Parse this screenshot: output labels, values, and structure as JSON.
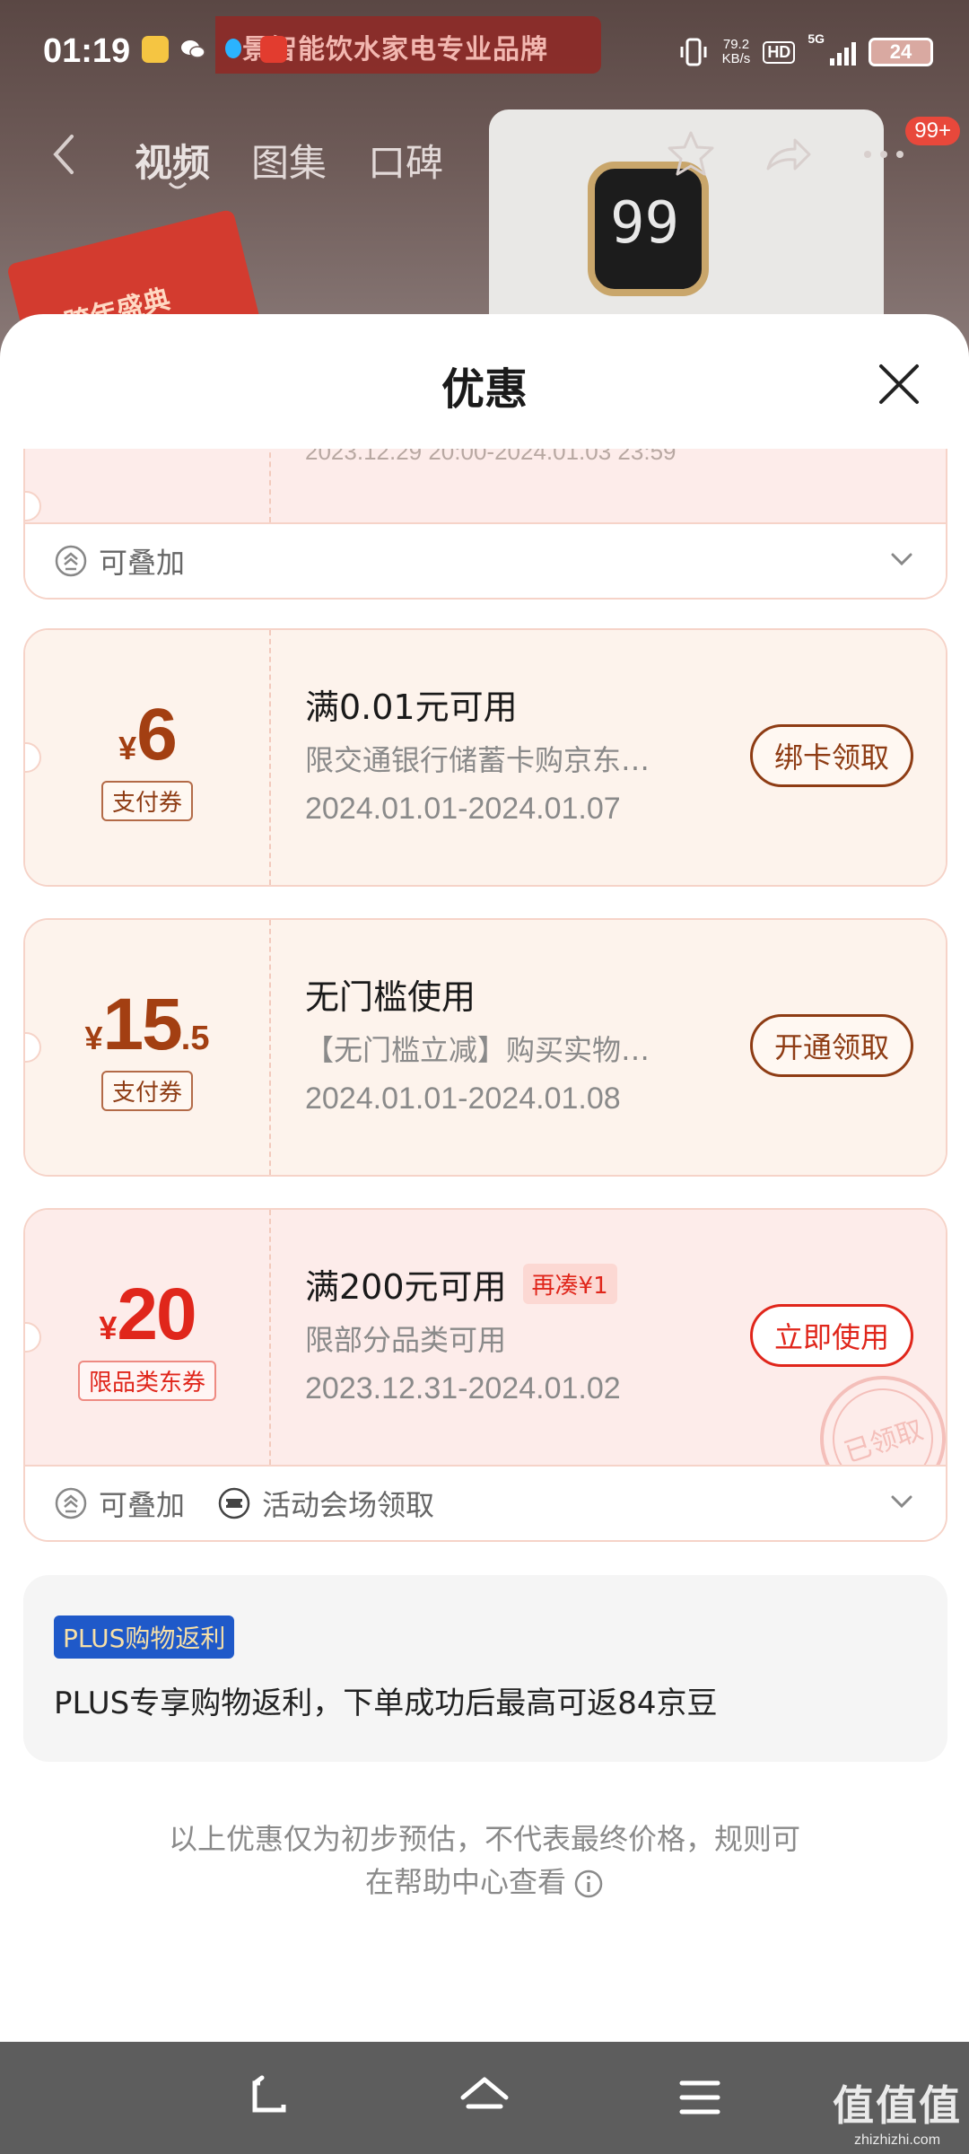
{
  "status_bar": {
    "time": "01:19",
    "net_speed_value": "79.2",
    "net_speed_unit": "KB/s",
    "hd": "HD",
    "network": "5G",
    "battery": "24"
  },
  "background": {
    "banner_text": "景智能饮水家电专业品牌",
    "display_temp": "99",
    "promo_text": "跨年盛典",
    "tabs": [
      "视频",
      "图集",
      "口碑"
    ],
    "message_badge": "99+"
  },
  "sheet": {
    "title": "优惠",
    "coupons_partial": {
      "date": "2023.12.29 20:00-2024.01.03 23:59",
      "footer_stackable": "可叠加"
    },
    "coupons": [
      {
        "currency": "¥",
        "amount_int": "6",
        "amount_dec": "",
        "type": "支付券",
        "title": "满0.01元可用",
        "desc": "限交通银行储蓄卡购京东…",
        "date": "2024.01.01-2024.01.07",
        "action": "绑卡领取"
      },
      {
        "currency": "¥",
        "amount_int": "15",
        "amount_dec": ".5",
        "type": "支付券",
        "title": "无门槛使用",
        "desc": "【无门槛立减】购买实物…",
        "date": "2024.01.01-2024.01.08",
        "action": "开通领取"
      },
      {
        "currency": "¥",
        "amount_int": "20",
        "amount_dec": "",
        "type": "限品类东券",
        "title": "满200元可用",
        "extra_tag": "再凑¥1",
        "desc": "限部分品类可用",
        "date": "2023.12.31-2024.01.02",
        "action": "立即使用",
        "stamp": "已领取",
        "footer_stackable": "可叠加",
        "footer_source": "活动会场领取"
      }
    ],
    "plus": {
      "badge": "PLUS购物返利",
      "text": "PLUS专享购物返利，下单成功后最高可返84京豆"
    },
    "notice_line1": "以上优惠仅为初步预估，不代表最终价格，规则可",
    "notice_line2": "在帮助中心查看"
  },
  "watermark": {
    "logo": "值值值",
    "url": "zhizhizhi.com"
  },
  "colors": {
    "accent_red": "#e0261b",
    "accent_brown": "#8e3c14",
    "plus_blue": "#1f59c9"
  }
}
